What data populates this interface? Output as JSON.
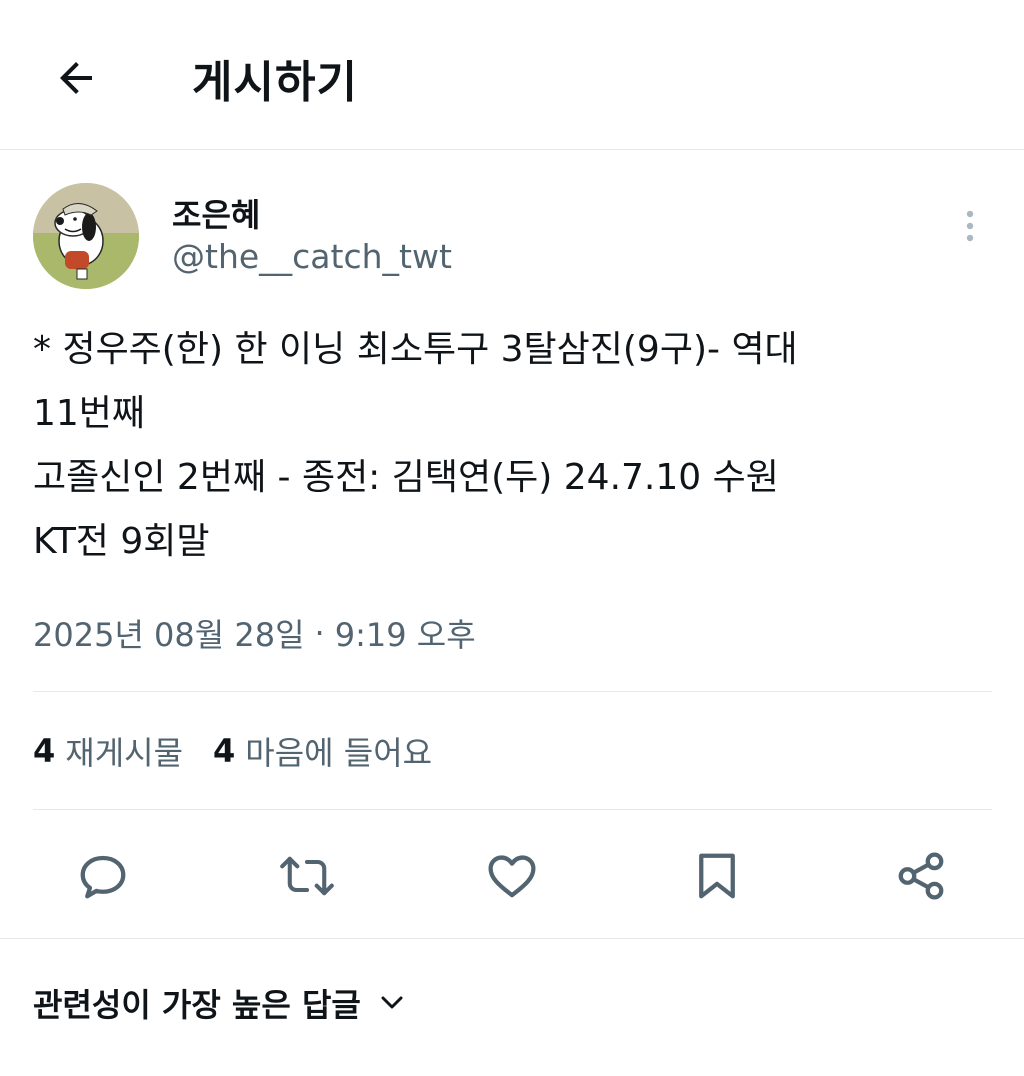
{
  "header": {
    "title": "게시하기",
    "back_icon": "arrow-left-icon"
  },
  "author": {
    "display_name": "조은혜",
    "handle": "@the__catch_twt",
    "avatar": "snoopy-avatar"
  },
  "tweet": {
    "lines": [
      "* 정우주(한) 한 이닝 최소투구 3탈삼진(9구)- 역대",
      "11번째",
      "고졸신인 2번째 - 종전: 김택연(두) 24.7.10 수원",
      "KT전 9회말"
    ],
    "date": "2025년 08월 28일",
    "separator": "·",
    "time": "9:19 오후"
  },
  "stats": {
    "retweets_count": "4",
    "retweets_label": "재게시물",
    "likes_count": "4",
    "likes_label": "마음에 들어요"
  },
  "actions": [
    "reply-icon",
    "retweet-icon",
    "like-icon",
    "bookmark-icon",
    "share-icon"
  ],
  "replies": {
    "sort_label": "관련성이 가장 높은 답글"
  },
  "colors": {
    "text_primary": "#0f1419",
    "text_secondary": "#536471",
    "divider": "#e6e9ec"
  }
}
